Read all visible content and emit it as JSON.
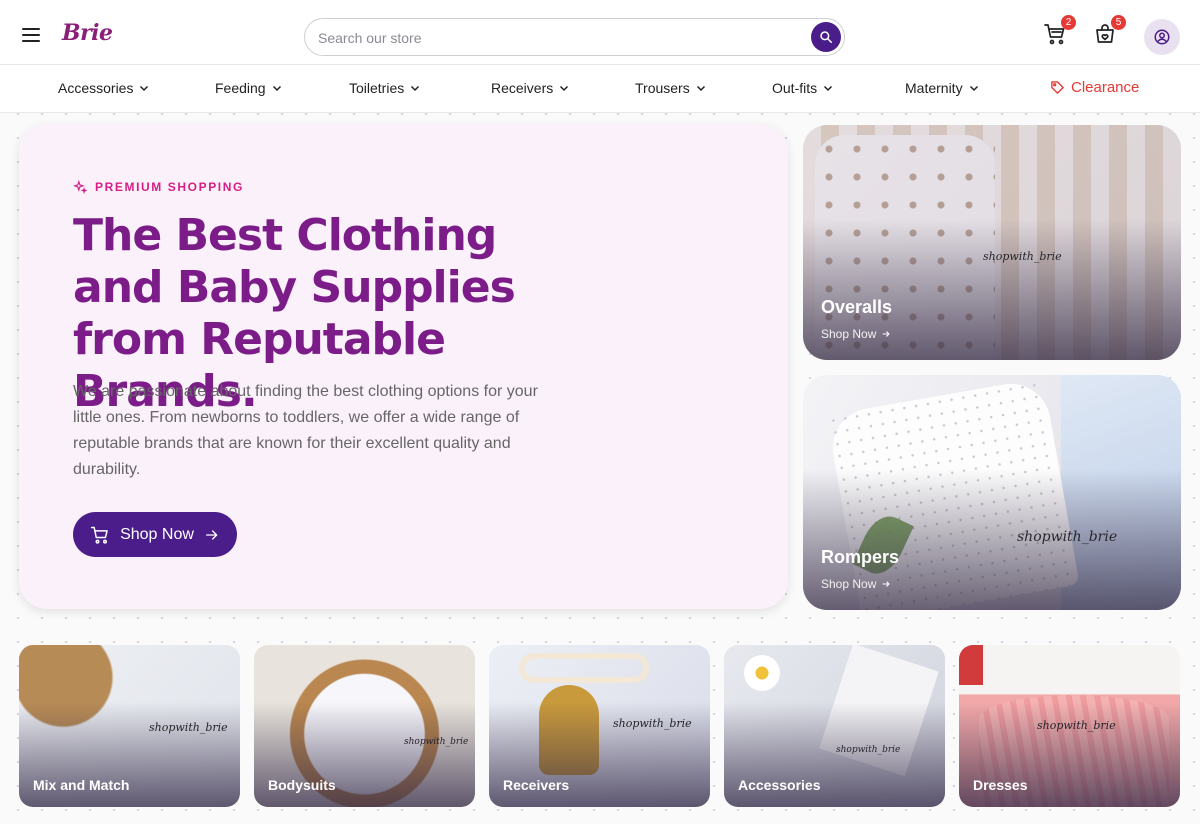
{
  "header": {
    "logo": "Brie",
    "search_placeholder": "Search our store",
    "cart_count": "2",
    "wishlist_count": "5"
  },
  "nav": {
    "items": [
      "Accessories",
      "Feeding",
      "Toiletries",
      "Receivers",
      "Trousers",
      "Out-fits",
      "Maternity"
    ],
    "clearance": "Clearance"
  },
  "hero": {
    "eyebrow": "PREMIUM SHOPPING",
    "title": "The Best Clothing and Baby Supplies from Reputable Brands.",
    "description": "We are passionate about finding the best clothing options for your little ones. From newborns to toddlers, we offer a wide range of reputable brands that are known for their excellent quality and durability.",
    "cta": "Shop Now"
  },
  "featured": [
    {
      "title": "Overalls",
      "link": "Shop Now",
      "watermark": "shopwith_brie"
    },
    {
      "title": "Rompers",
      "link": "Shop Now",
      "watermark": "shopwith_brie"
    }
  ],
  "categories": [
    {
      "label": "Mix and Match",
      "watermark": "shopwith_brie"
    },
    {
      "label": "Bodysuits",
      "watermark": "shopwith_brie"
    },
    {
      "label": "Receivers",
      "watermark": "shopwith_brie"
    },
    {
      "label": "Accessories",
      "watermark": "shopwith_brie"
    },
    {
      "label": "Dresses",
      "watermark": "shopwith_brie"
    }
  ],
  "colors": {
    "brand_purple": "#4b1d8a",
    "title_purple": "#7b1c88",
    "accent_pink": "#d61f87",
    "clearance_red": "#e53935",
    "hero_bg": "#fbf1fb"
  },
  "icons": [
    "menu-icon",
    "search-icon",
    "cart-icon",
    "wishlist-bag-icon",
    "account-icon",
    "chevron-down-icon",
    "tag-icon",
    "sparkle-icon",
    "arrow-right-icon"
  ]
}
